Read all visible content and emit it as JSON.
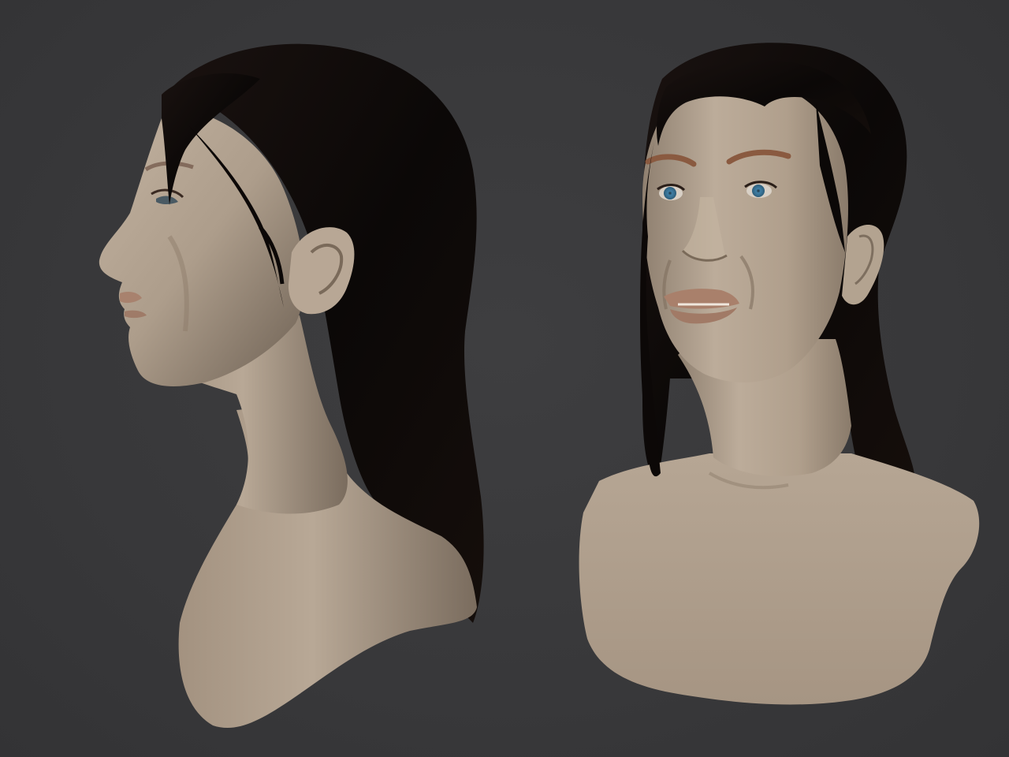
{
  "scene": {
    "background_color": "#39393b",
    "skin_color": "#b3a391",
    "hair_color": "#0d0908",
    "eye_color": "#3f7fa6",
    "views": [
      {
        "name": "profile-left-view",
        "subject": "female-head-bust"
      },
      {
        "name": "three-quarter-front-view",
        "subject": "female-head-bust"
      }
    ]
  }
}
